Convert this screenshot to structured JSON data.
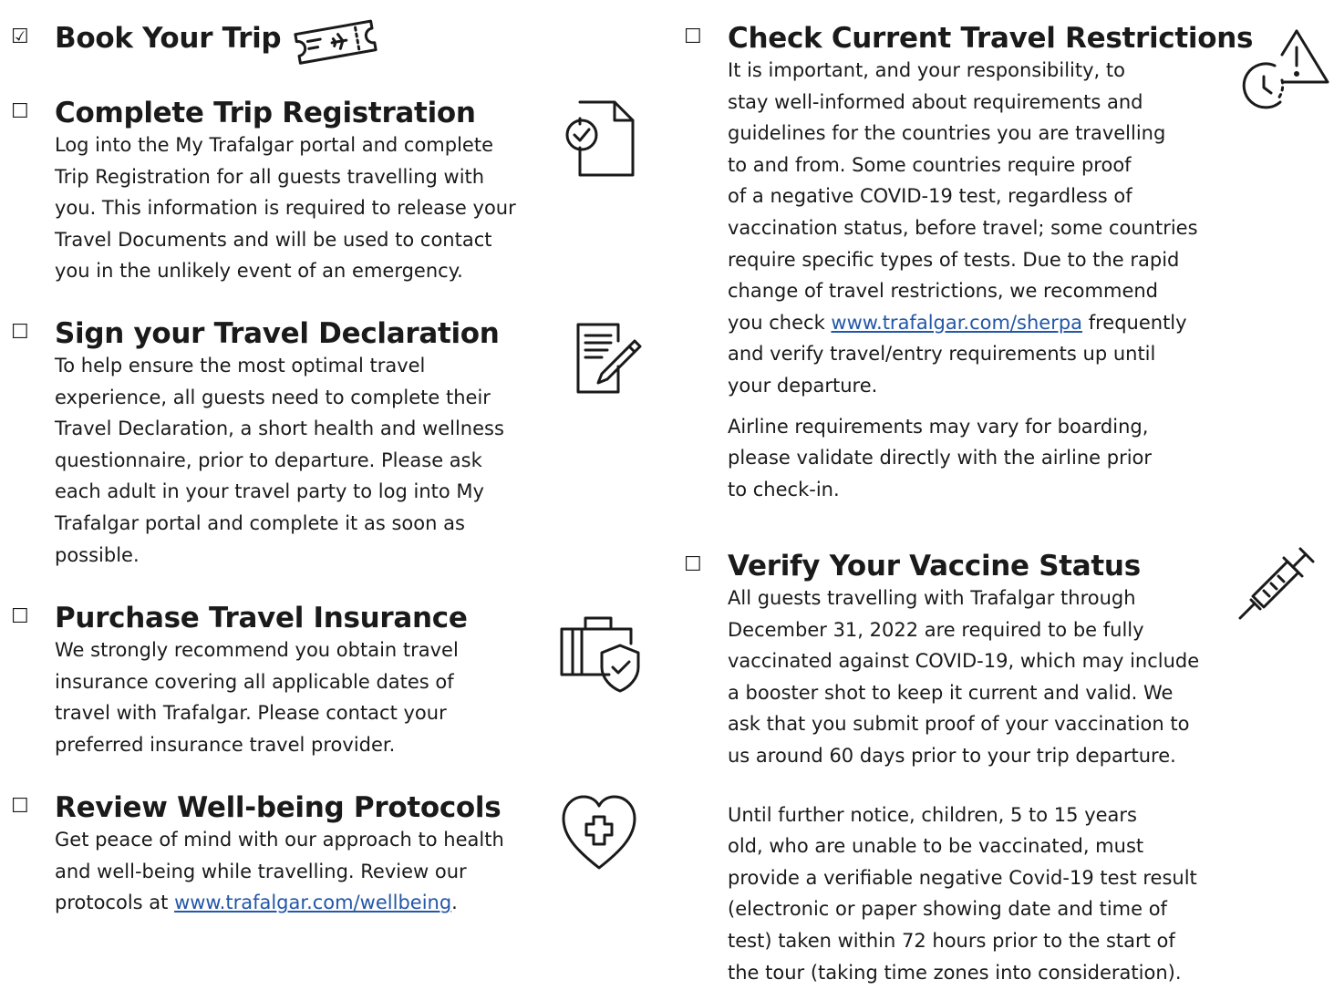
{
  "left_column": {
    "book_trip": {
      "checkbox": "☑",
      "title": "Book Your Trip",
      "icon": "ticket-icon"
    },
    "registration": {
      "checkbox": "☐",
      "title": "Complete Trip Registration",
      "icon": "document-check-icon",
      "lines": [
        "Log into the My Trafalgar portal and complete",
        "Trip Registration for all guests travelling with",
        "you. This information is required to release your",
        "Travel Documents and will be used to contact",
        "you in the unlikely event of an emergency."
      ]
    },
    "declaration": {
      "checkbox": "☐",
      "title": "Sign your Travel Declaration",
      "icon": "form-pencil-icon",
      "lines": [
        "To help ensure the most optimal travel",
        "experience, all guests need to complete their",
        "Travel Declaration, a short health and wellness",
        "questionnaire, prior to departure. Please ask",
        "each adult in your travel party to log into My",
        "Trafalgar portal and complete it as soon as",
        "possible."
      ]
    },
    "insurance": {
      "checkbox": "☐",
      "title": "Purchase Travel Insurance",
      "icon": "luggage-shield-icon",
      "lines": [
        "We strongly recommend you obtain travel",
        "insurance covering all applicable dates of",
        "travel with Trafalgar. Please contact your",
        "preferred insurance travel provider."
      ]
    },
    "wellbeing": {
      "checkbox": "☐",
      "title": "Review Well-being Protocols",
      "icon": "heart-cross-icon",
      "lines": [
        "Get peace of mind with our approach to health",
        "and well-being while travelling. Review our"
      ],
      "last_prefix": "protocols at ",
      "link": "www.trafalgar.com/wellbeing",
      "last_suffix": "."
    }
  },
  "right_column": {
    "restrictions": {
      "checkbox": "☐",
      "title": "Check Current Travel Restrictions",
      "icon": "clock-warning-icon",
      "lines": [
        "It is important, and your responsibility, to",
        "stay well-informed about requirements and",
        "guidelines for the countries you are travelling",
        "to and from. Some countries require proof",
        "of a negative COVID-19 test, regardless of",
        "vaccination status, before travel; some countries",
        "require specific types of tests. Due to the rapid",
        "change of travel restrictions, we recommend"
      ],
      "link_prefix": "you check ",
      "link": "www.trafalgar.com/sherpa",
      "link_suffix": " frequently",
      "lines_after": [
        "and verify travel/entry requirements up until",
        "your departure."
      ],
      "airline_lines": [
        "Airline requirements may vary for boarding,",
        "please validate directly with the airline prior",
        "to check-in."
      ]
    },
    "vaccine": {
      "checkbox": "☐",
      "title": "Verify Your Vaccine Status",
      "icon": "syringe-icon",
      "lines": [
        "All guests travelling with Trafalgar through",
        "December 31, 2022 are required to be fully",
        "vaccinated against COVID-19, which may include",
        "a booster shot to keep it current and valid. We",
        "ask that you submit proof of your vaccination to",
        "us around 60 days prior to your trip departure."
      ],
      "children_lines": [
        "Until further notice, children, 5 to 15 years",
        "old, who are unable to be vaccinated, must",
        "provide a verifiable negative Covid-19 test result",
        "(electronic or paper showing date and time of",
        "test) taken within 72 hours prior to the start of",
        "the tour (taking time zones into consideration)."
      ]
    }
  },
  "colors": {
    "text": "#1a1a1a",
    "link": "#2357a7"
  }
}
